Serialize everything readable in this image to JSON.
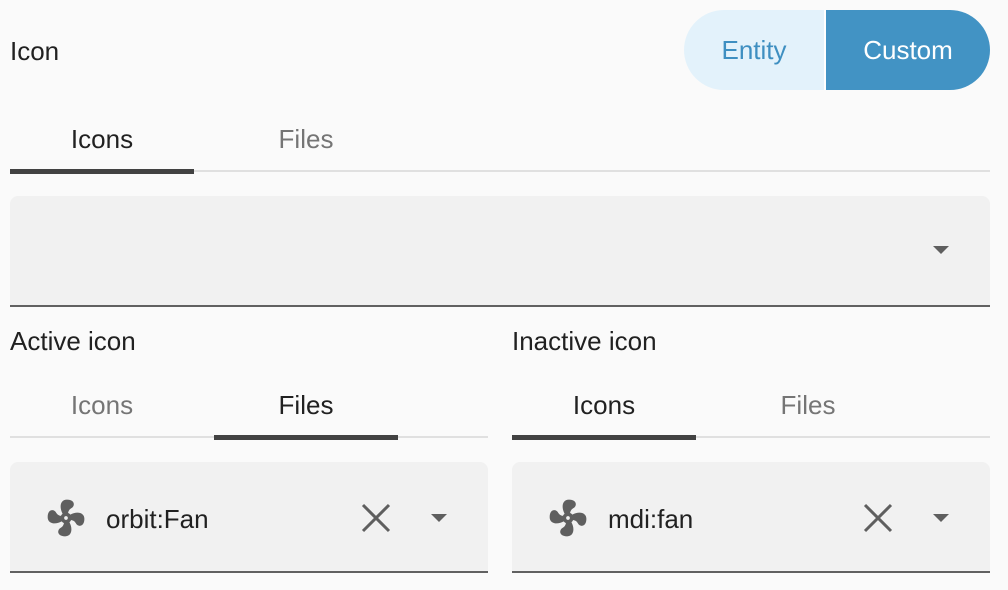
{
  "icon_section": {
    "title": "Icon",
    "toggle": {
      "entity_label": "Entity",
      "custom_label": "Custom",
      "selected": "Custom"
    },
    "tabs": [
      {
        "label": "Icons",
        "active": true
      },
      {
        "label": "Files",
        "active": false
      }
    ],
    "select_value": ""
  },
  "active_icon": {
    "title": "Active icon",
    "tabs": [
      {
        "label": "Icons",
        "active": false
      },
      {
        "label": "Files",
        "active": true
      }
    ],
    "value": "orbit:Fan",
    "icon": "fan-icon"
  },
  "inactive_icon": {
    "title": "Inactive icon",
    "tabs": [
      {
        "label": "Icons",
        "active": true
      },
      {
        "label": "Files",
        "active": false
      }
    ],
    "value": "mdi:fan",
    "icon": "fan-icon"
  },
  "colors": {
    "accent": "#4293c4",
    "accent_light": "#e3f2fb"
  }
}
